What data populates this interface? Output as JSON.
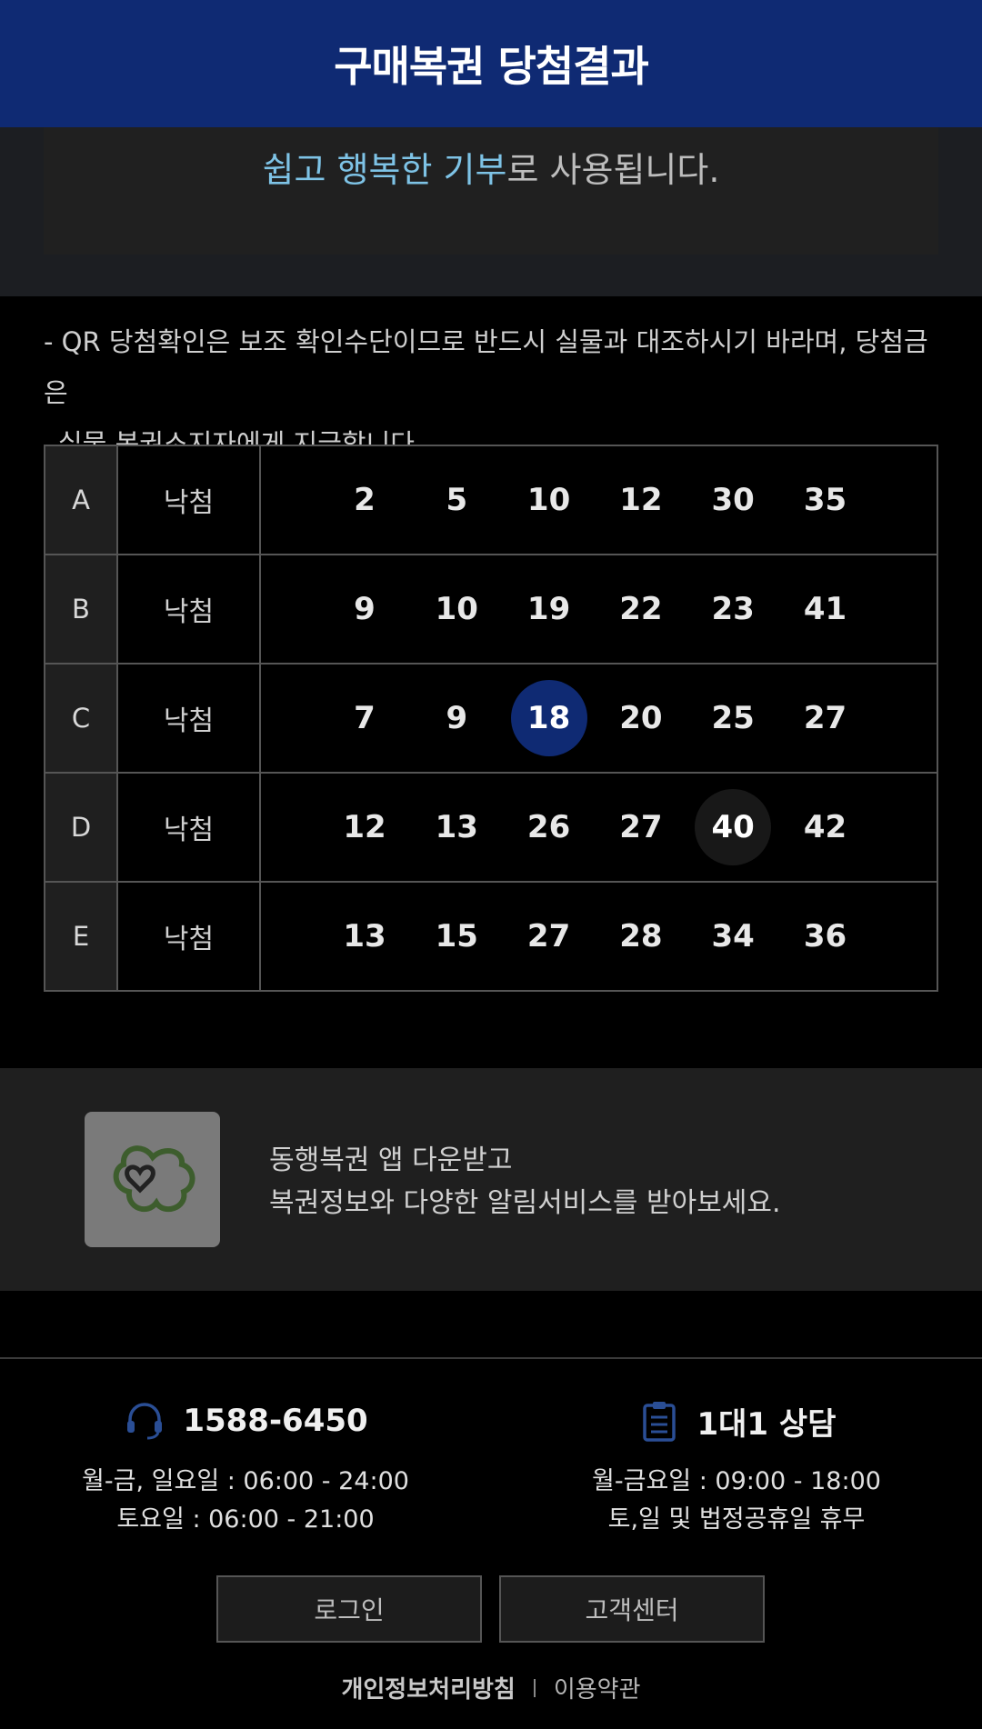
{
  "header": {
    "title": "구매복권 당첨결과"
  },
  "promo": {
    "highlight": "쉽고 행복한 기부",
    "rest": "로 사용됩니다."
  },
  "notice": {
    "line1": "- QR 당첨확인은 보조 확인수단이므로 반드시 실물과 대조하시기 바라며, 당첨금은",
    "line2": "실물 복권소지자에게 지급합니다."
  },
  "results": [
    {
      "slot": "A",
      "status": "낙첨",
      "numbers": [
        "2",
        "5",
        "10",
        "12",
        "30",
        "35"
      ]
    },
    {
      "slot": "B",
      "status": "낙첨",
      "numbers": [
        "9",
        "10",
        "19",
        "22",
        "23",
        "41"
      ]
    },
    {
      "slot": "C",
      "status": "낙첨",
      "numbers": [
        "7",
        "9",
        "18",
        "20",
        "25",
        "27"
      ]
    },
    {
      "slot": "D",
      "status": "낙첨",
      "numbers": [
        "12",
        "13",
        "26",
        "27",
        "40",
        "42"
      ]
    },
    {
      "slot": "E",
      "status": "낙첨",
      "numbers": [
        "13",
        "15",
        "27",
        "28",
        "34",
        "36"
      ]
    }
  ],
  "highlight_colors": {
    "blue": "#0f2a73",
    "dark": "#181818"
  },
  "app_banner": {
    "icon": "donghaeng-lottery-app-icon",
    "line1": "동행복권 앱 다운받고",
    "line2": "복권정보와 다양한 알림서비스를 받아보세요."
  },
  "contact_phone": {
    "icon": "headset-icon",
    "number": "1588-6450",
    "hours1": "월-금, 일요일 : 06:00 - 24:00",
    "hours2": "토요일 : 06:00 - 21:00"
  },
  "contact_chat": {
    "icon": "clipboard-icon",
    "label": "1대1 상담",
    "hours1": "월-금요일 : 09:00 - 18:00",
    "hours2": "토,일 및 법정공휴일 휴무"
  },
  "buttons": {
    "login": "로그인",
    "customer_center": "고객센터"
  },
  "footer": {
    "privacy": "개인정보처리방침",
    "terms": "이용약관"
  }
}
